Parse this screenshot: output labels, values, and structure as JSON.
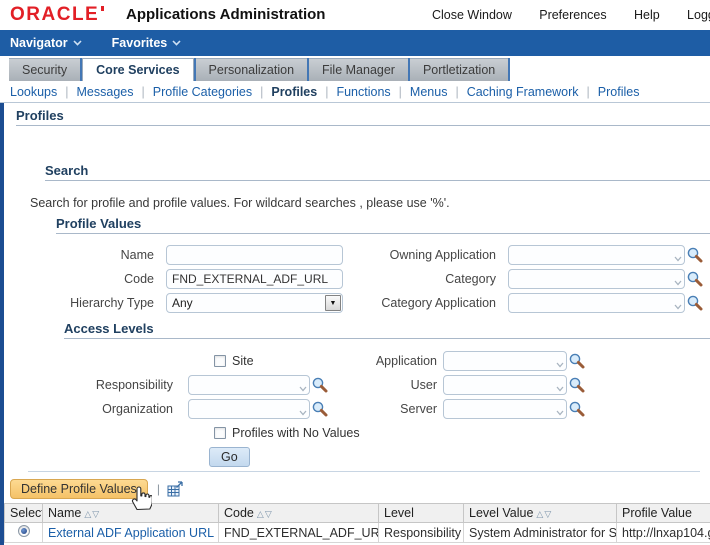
{
  "colors": {
    "navbar_blue": "#1e5da5",
    "left_border_blue": "#1c4d92",
    "link_blue": "#1b5fa8",
    "heading_navy": "#204060",
    "oracle_red": "#e21f26",
    "define_button_gold": "#f5c267",
    "go_button_blue": "#c3d9ee"
  },
  "header": {
    "logo": "ORACLE",
    "app_title": "Applications Administration",
    "links": [
      {
        "label": "Close Window"
      },
      {
        "label": "Preferences"
      },
      {
        "label": "Help"
      },
      {
        "label": "Logg"
      }
    ]
  },
  "navbar": {
    "items": [
      {
        "label": "Navigator"
      },
      {
        "label": "Favorites"
      }
    ]
  },
  "tabs": {
    "active": "Core Services",
    "items": [
      {
        "label": "Security"
      },
      {
        "label": "Core Services"
      },
      {
        "label": "Personalization"
      },
      {
        "label": "File Manager"
      },
      {
        "label": "Portletization"
      }
    ]
  },
  "subnav": {
    "current": "Profiles",
    "items": [
      {
        "label": "Lookups"
      },
      {
        "label": "Messages"
      },
      {
        "label": "Profile Categories"
      },
      {
        "label": "Profiles"
      },
      {
        "label": "Functions"
      },
      {
        "label": "Menus"
      },
      {
        "label": "Caching Framework"
      },
      {
        "label": "Profiles"
      }
    ]
  },
  "page": {
    "heading": "Profiles"
  },
  "search": {
    "heading": "Search",
    "description": "Search for profile and profile values. For wildcard searches , please use '%'.",
    "profile_values": {
      "heading": "Profile Values",
      "name": {
        "label": "Name",
        "value": ""
      },
      "code": {
        "label": "Code",
        "value": "FND_EXTERNAL_ADF_URL"
      },
      "hierarchy_type": {
        "label": "Hierarchy Type",
        "value": "Any"
      },
      "owning_application": {
        "label": "Owning Application",
        "value": ""
      },
      "category": {
        "label": "Category",
        "value": ""
      },
      "category_application": {
        "label": "Category Application",
        "value": ""
      }
    },
    "access_levels": {
      "heading": "Access Levels",
      "site": {
        "label": "Site",
        "checked": false
      },
      "responsibility": {
        "label": "Responsibility",
        "value": ""
      },
      "organization": {
        "label": "Organization",
        "value": ""
      },
      "application": {
        "label": "Application",
        "value": ""
      },
      "user": {
        "label": "User",
        "value": ""
      },
      "server": {
        "label": "Server",
        "value": ""
      },
      "profiles_with_no_values": {
        "label": "Profiles with No Values",
        "checked": false
      }
    },
    "go_button": "Go"
  },
  "results": {
    "define_profile_values_button": "Define Profile Values",
    "columns": [
      {
        "label": "Select",
        "sortable": false
      },
      {
        "label": "Name",
        "sortable": true
      },
      {
        "label": "Code",
        "sortable": true
      },
      {
        "label": "Level",
        "sortable": false
      },
      {
        "label": "Level Value",
        "sortable": true
      },
      {
        "label": "Profile Value",
        "sortable": false
      }
    ],
    "rows": [
      {
        "selected": true,
        "name": "External ADF Application URL",
        "code": "FND_EXTERNAL_ADF_URL",
        "level": "Responsibility",
        "level_value": "System Administrator for SA",
        "profile_value": "http://lnxap104.g"
      }
    ]
  }
}
